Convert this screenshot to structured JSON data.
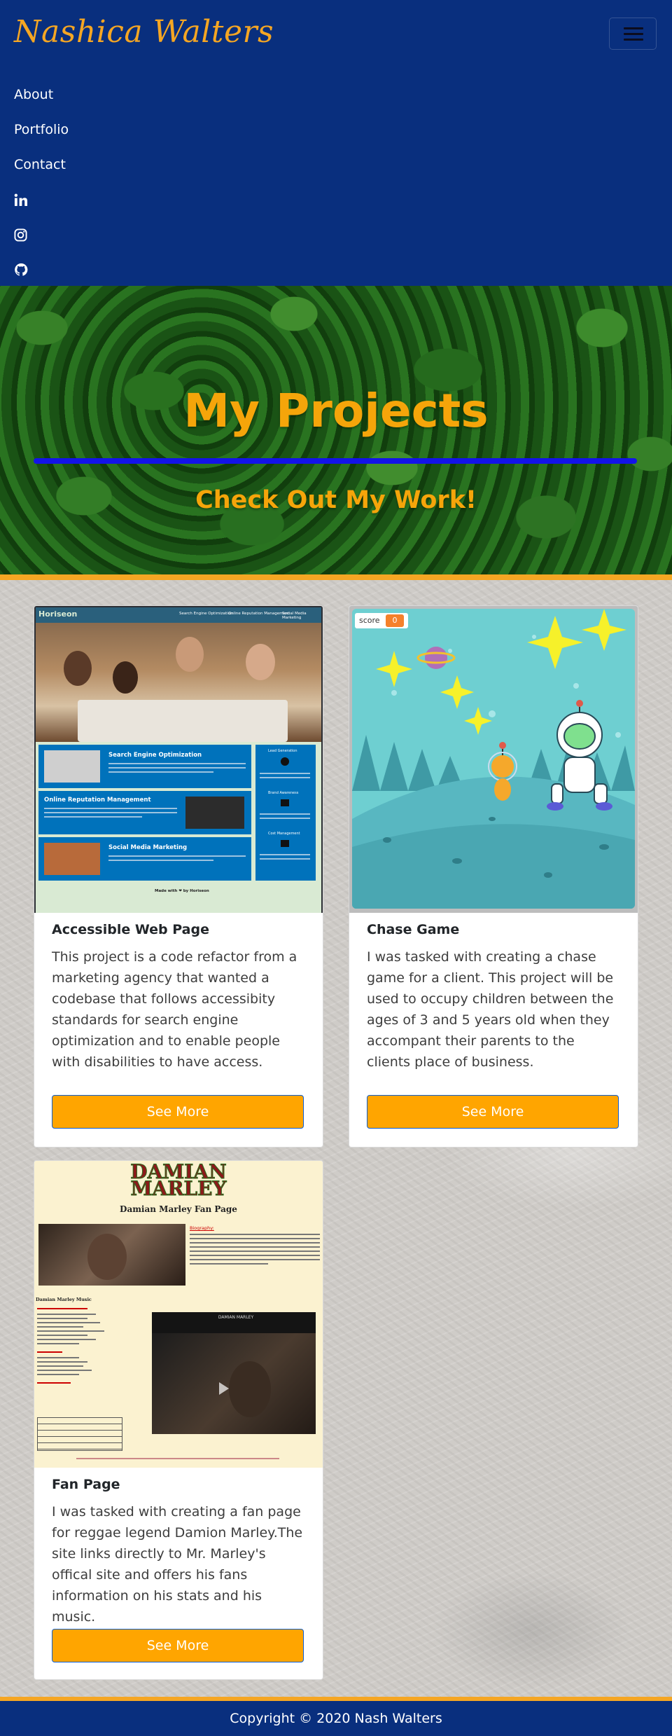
{
  "header": {
    "brand": "Nashica Walters",
    "nav": [
      {
        "label": "About"
      },
      {
        "label": "Portfolio"
      },
      {
        "label": "Contact"
      }
    ],
    "social_icons": [
      "linkedin-icon",
      "instagram-icon",
      "github-icon"
    ]
  },
  "hero": {
    "title": "My Projects",
    "subtitle": "Check Out My Work!"
  },
  "projects": [
    {
      "title": "Accessible Web Page",
      "description": "This project is a code refactor from a marketing agency that wanted a codebase that follows accessibity standards for search engine optimization and to enable people with disabilities to have access.",
      "button": "See More",
      "thumb": {
        "brand": "Horiseon",
        "nav": [
          "Search Engine Optimization",
          "Online Reputation Management",
          "Social Media Marketing"
        ],
        "sections": [
          "Search Engine Optimization",
          "Online Reputation Management",
          "Social Media Marketing"
        ],
        "side": [
          "Lead Generation",
          "Brand Awareness",
          "Cost Management"
        ],
        "footer": "Made with ❤ by Horiseon"
      }
    },
    {
      "title": "Chase Game",
      "description": "I was tasked with creating a chase game for a client. This project will be used to occupy children between the ages of 3 and 5 years old when they accompant their parents to the clients place of business.",
      "button": "See More",
      "thumb": {
        "score_label": "score",
        "score_value": "0"
      }
    },
    {
      "title": "Fan Page",
      "description": "I was tasked with creating a fan page for reggae legend Damion Marley.The site links directly to Mr. Marley's offical site and offers his fans information on his stats and his music.",
      "button": "See More",
      "thumb": {
        "logo_line1": "DAMIAN",
        "logo_line2": "MARLEY",
        "page_title": "Damian Marley Fan Page",
        "bio_label": "Biography:",
        "music_label": "Damian Marley Music",
        "video_logo": "DAMIAN MARLEY"
      }
    }
  ],
  "footer": {
    "copyright": "Copyright © 2020 Nash Walters"
  },
  "colors": {
    "navy": "#092f7e",
    "accent": "#f5a623",
    "button": "#ffa500",
    "rule": "#1313e8"
  }
}
